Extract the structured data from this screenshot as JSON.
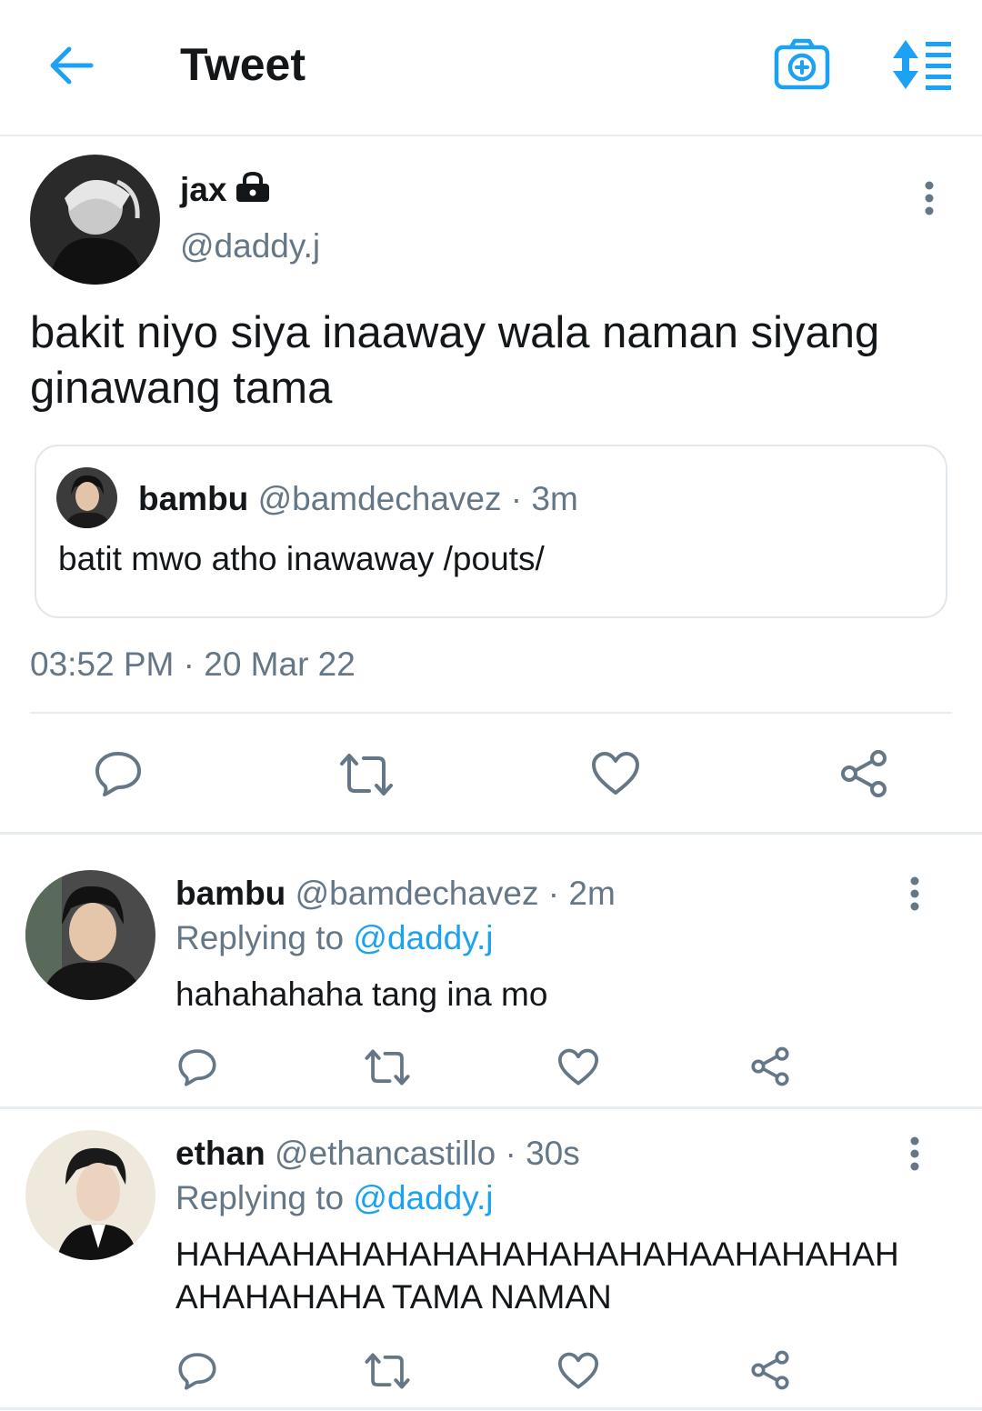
{
  "header": {
    "title": "Tweet"
  },
  "main_tweet": {
    "name": "jax",
    "handle": "@daddy.j",
    "text_line1": "bakit niyo siya inaaway wala naman siyang",
    "text_line2": "ginawang tama",
    "quote": {
      "name": "bambu",
      "handle": "@bamdechavez",
      "time": "· 3m",
      "text": "batit mwo atho inawaway /pouts/"
    },
    "timestamp": "03:52 PM · 20 Mar 22"
  },
  "replies": [
    {
      "name": "bambu",
      "handle": "@bamdechavez",
      "time": "· 2m",
      "replying_prefix": "Replying to",
      "replying_to": "@daddy.j",
      "text_line1": "hahahahaha tang ina mo",
      "text_line2": ""
    },
    {
      "name": "ethan",
      "handle": "@ethancastillo",
      "time": "· 30s",
      "replying_prefix": "Replying to",
      "replying_to": "@daddy.j",
      "text_line1": "HAHAAHAHAHAHAHAHAHAHAHAAHAHAHAH",
      "text_line2": "AHAHAHAHA TAMA NAMAN"
    }
  ],
  "colors": {
    "accent": "#1da1f2",
    "text": "#14171a",
    "secondary": "#657786",
    "divider": "#e6ecf0"
  }
}
